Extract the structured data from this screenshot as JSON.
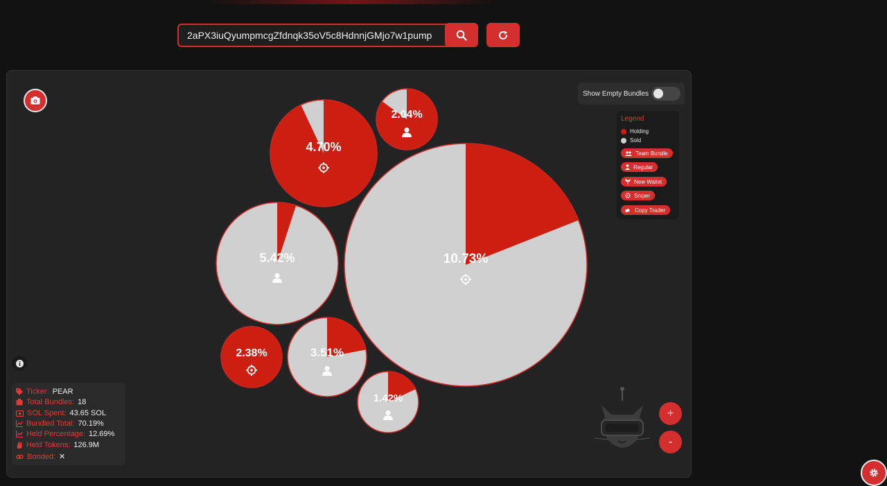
{
  "search": {
    "value": "2aPX3iuQyumpmcgZfdnqk35oV5c8HdnnjGMjo7w1pump"
  },
  "buttons": {
    "search_icon": "search-icon",
    "refresh_icon": "refresh-icon",
    "camera_icon": "camera-icon"
  },
  "toggle": {
    "label": "Show Empty Bundles",
    "on": false
  },
  "legend": {
    "title": "Legend",
    "holding": "Holding",
    "sold": "Sold",
    "tags": [
      "Team Bundle",
      "Regular",
      "New Wallet",
      "Sniper",
      "Copy Trader"
    ]
  },
  "colors": {
    "accent": "#d32f2f",
    "holding": "#cc1f12",
    "sold": "#d0d0d0"
  },
  "bubbles": [
    {
      "label": "10.73%",
      "icon": "crosshair-icon",
      "held_fraction": 0.19
    },
    {
      "label": "4.70%",
      "icon": "crosshair-icon",
      "held_fraction": 0.93
    },
    {
      "label": "2.04%",
      "icon": "user-icon",
      "held_fraction": 0.85
    },
    {
      "label": "5.42%",
      "icon": "user-icon",
      "held_fraction": 0.05
    },
    {
      "label": "2.38%",
      "icon": "crosshair-icon",
      "held_fraction": 1.0
    },
    {
      "label": "3.51%",
      "icon": "user-icon",
      "held_fraction": 0.22
    },
    {
      "label": "1.42%",
      "icon": "user-icon",
      "held_fraction": 0.18
    }
  ],
  "stats": {
    "ticker_key": "Ticker:",
    "ticker_val": "PEAR",
    "bundles_key": "Total Bundles:",
    "bundles_val": "18",
    "sol_key": "SOL Spent:",
    "sol_val": "43.65 SOL",
    "bundled_key": "Bundled Total:",
    "bundled_val": "70.19%",
    "heldpct_key": "Held Percentage:",
    "heldpct_val": "12.69%",
    "heldtok_key": "Held Tokens:",
    "heldtok_val": "126.9M",
    "bonded_key": "Bonded:",
    "bonded_val": "✕"
  },
  "zoom": {
    "in": "+",
    "out": "-"
  }
}
